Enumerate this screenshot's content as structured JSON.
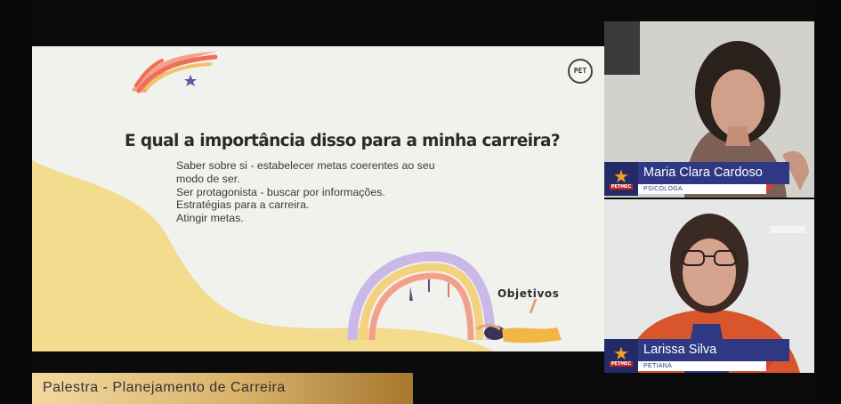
{
  "slide": {
    "title": "E qual a importância disso para a minha carreira?",
    "bullets": [
      "Saber sobre si - estabelecer metas coerentes ao seu",
      "modo de ser.",
      "Ser protagonista - buscar por informações.",
      "Estratégias para a carreira.",
      "Atingir metas."
    ],
    "section_label": "Objetivos",
    "logo_text": "PET"
  },
  "participants": [
    {
      "name": "Maria Clara Cardoso",
      "role": "PSICÓLOGA",
      "org": "PETMEC"
    },
    {
      "name": "Larissa Silva",
      "role": "PETIANA",
      "org": "PETMEC"
    }
  ],
  "banner": {
    "title": "Palestra - Planejamento de Carreira"
  },
  "colors": {
    "nameplate": "#2e3883",
    "emblem_star": "#f0a21d",
    "slide_yellow": "#f3dc8e",
    "banner_gold": "#d8b26a"
  }
}
